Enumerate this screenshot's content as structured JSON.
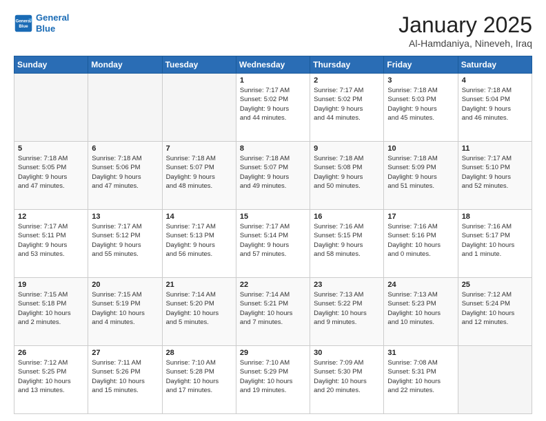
{
  "header": {
    "logo_line1": "General",
    "logo_line2": "Blue",
    "title": "January 2025",
    "subtitle": "Al-Hamdaniya, Nineveh, Iraq"
  },
  "weekdays": [
    "Sunday",
    "Monday",
    "Tuesday",
    "Wednesday",
    "Thursday",
    "Friday",
    "Saturday"
  ],
  "weeks": [
    [
      {
        "day": "",
        "info": ""
      },
      {
        "day": "",
        "info": ""
      },
      {
        "day": "",
        "info": ""
      },
      {
        "day": "1",
        "info": "Sunrise: 7:17 AM\nSunset: 5:02 PM\nDaylight: 9 hours\nand 44 minutes."
      },
      {
        "day": "2",
        "info": "Sunrise: 7:17 AM\nSunset: 5:02 PM\nDaylight: 9 hours\nand 44 minutes."
      },
      {
        "day": "3",
        "info": "Sunrise: 7:18 AM\nSunset: 5:03 PM\nDaylight: 9 hours\nand 45 minutes."
      },
      {
        "day": "4",
        "info": "Sunrise: 7:18 AM\nSunset: 5:04 PM\nDaylight: 9 hours\nand 46 minutes."
      }
    ],
    [
      {
        "day": "5",
        "info": "Sunrise: 7:18 AM\nSunset: 5:05 PM\nDaylight: 9 hours\nand 47 minutes."
      },
      {
        "day": "6",
        "info": "Sunrise: 7:18 AM\nSunset: 5:06 PM\nDaylight: 9 hours\nand 47 minutes."
      },
      {
        "day": "7",
        "info": "Sunrise: 7:18 AM\nSunset: 5:07 PM\nDaylight: 9 hours\nand 48 minutes."
      },
      {
        "day": "8",
        "info": "Sunrise: 7:18 AM\nSunset: 5:07 PM\nDaylight: 9 hours\nand 49 minutes."
      },
      {
        "day": "9",
        "info": "Sunrise: 7:18 AM\nSunset: 5:08 PM\nDaylight: 9 hours\nand 50 minutes."
      },
      {
        "day": "10",
        "info": "Sunrise: 7:18 AM\nSunset: 5:09 PM\nDaylight: 9 hours\nand 51 minutes."
      },
      {
        "day": "11",
        "info": "Sunrise: 7:17 AM\nSunset: 5:10 PM\nDaylight: 9 hours\nand 52 minutes."
      }
    ],
    [
      {
        "day": "12",
        "info": "Sunrise: 7:17 AM\nSunset: 5:11 PM\nDaylight: 9 hours\nand 53 minutes."
      },
      {
        "day": "13",
        "info": "Sunrise: 7:17 AM\nSunset: 5:12 PM\nDaylight: 9 hours\nand 55 minutes."
      },
      {
        "day": "14",
        "info": "Sunrise: 7:17 AM\nSunset: 5:13 PM\nDaylight: 9 hours\nand 56 minutes."
      },
      {
        "day": "15",
        "info": "Sunrise: 7:17 AM\nSunset: 5:14 PM\nDaylight: 9 hours\nand 57 minutes."
      },
      {
        "day": "16",
        "info": "Sunrise: 7:16 AM\nSunset: 5:15 PM\nDaylight: 9 hours\nand 58 minutes."
      },
      {
        "day": "17",
        "info": "Sunrise: 7:16 AM\nSunset: 5:16 PM\nDaylight: 10 hours\nand 0 minutes."
      },
      {
        "day": "18",
        "info": "Sunrise: 7:16 AM\nSunset: 5:17 PM\nDaylight: 10 hours\nand 1 minute."
      }
    ],
    [
      {
        "day": "19",
        "info": "Sunrise: 7:15 AM\nSunset: 5:18 PM\nDaylight: 10 hours\nand 2 minutes."
      },
      {
        "day": "20",
        "info": "Sunrise: 7:15 AM\nSunset: 5:19 PM\nDaylight: 10 hours\nand 4 minutes."
      },
      {
        "day": "21",
        "info": "Sunrise: 7:14 AM\nSunset: 5:20 PM\nDaylight: 10 hours\nand 5 minutes."
      },
      {
        "day": "22",
        "info": "Sunrise: 7:14 AM\nSunset: 5:21 PM\nDaylight: 10 hours\nand 7 minutes."
      },
      {
        "day": "23",
        "info": "Sunrise: 7:13 AM\nSunset: 5:22 PM\nDaylight: 10 hours\nand 9 minutes."
      },
      {
        "day": "24",
        "info": "Sunrise: 7:13 AM\nSunset: 5:23 PM\nDaylight: 10 hours\nand 10 minutes."
      },
      {
        "day": "25",
        "info": "Sunrise: 7:12 AM\nSunset: 5:24 PM\nDaylight: 10 hours\nand 12 minutes."
      }
    ],
    [
      {
        "day": "26",
        "info": "Sunrise: 7:12 AM\nSunset: 5:25 PM\nDaylight: 10 hours\nand 13 minutes."
      },
      {
        "day": "27",
        "info": "Sunrise: 7:11 AM\nSunset: 5:26 PM\nDaylight: 10 hours\nand 15 minutes."
      },
      {
        "day": "28",
        "info": "Sunrise: 7:10 AM\nSunset: 5:28 PM\nDaylight: 10 hours\nand 17 minutes."
      },
      {
        "day": "29",
        "info": "Sunrise: 7:10 AM\nSunset: 5:29 PM\nDaylight: 10 hours\nand 19 minutes."
      },
      {
        "day": "30",
        "info": "Sunrise: 7:09 AM\nSunset: 5:30 PM\nDaylight: 10 hours\nand 20 minutes."
      },
      {
        "day": "31",
        "info": "Sunrise: 7:08 AM\nSunset: 5:31 PM\nDaylight: 10 hours\nand 22 minutes."
      },
      {
        "day": "",
        "info": ""
      }
    ]
  ]
}
